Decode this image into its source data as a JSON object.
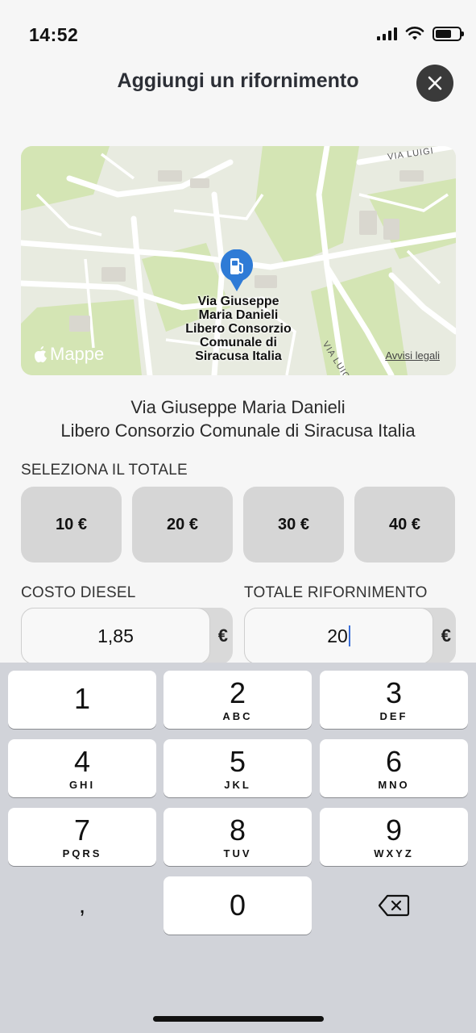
{
  "status_bar": {
    "time": "14:52"
  },
  "header": {
    "title": "Aggiungi un rifornimento"
  },
  "map": {
    "pin_label_lines": [
      "Via Giuseppe",
      "Maria Danieli",
      "Libero Consorzio",
      "Comunale di",
      "Siracusa Italia"
    ],
    "brand": "Mappe",
    "legal": "Avvisi legali",
    "street_top": "VIA LUIGI",
    "street_right": "VIA LUIGI DE"
  },
  "address": {
    "line1": "Via Giuseppe Maria Danieli",
    "line2": "Libero Consorzio Comunale di Siracusa Italia"
  },
  "total_section": {
    "label": "SELEZIONA IL TOTALE",
    "options": [
      "10 €",
      "20 €",
      "30 €",
      "40 €"
    ]
  },
  "diesel": {
    "label": "COSTO DIESEL",
    "value": "1,85",
    "unit": "€"
  },
  "refuel": {
    "label": "TOTALE RIFORNIMENTO",
    "value": "20",
    "unit": "€"
  },
  "keyboard": {
    "keys": [
      {
        "num": "1",
        "letters": ""
      },
      {
        "num": "2",
        "letters": "ABC"
      },
      {
        "num": "3",
        "letters": "DEF"
      },
      {
        "num": "4",
        "letters": "GHI"
      },
      {
        "num": "5",
        "letters": "JKL"
      },
      {
        "num": "6",
        "letters": "MNO"
      },
      {
        "num": "7",
        "letters": "PQRS"
      },
      {
        "num": "8",
        "letters": "TUV"
      },
      {
        "num": "9",
        "letters": "WXYZ"
      },
      {
        "num": "0",
        "letters": ""
      }
    ],
    "comma": ",",
    "delete_icon": "delete-backspace-icon"
  }
}
